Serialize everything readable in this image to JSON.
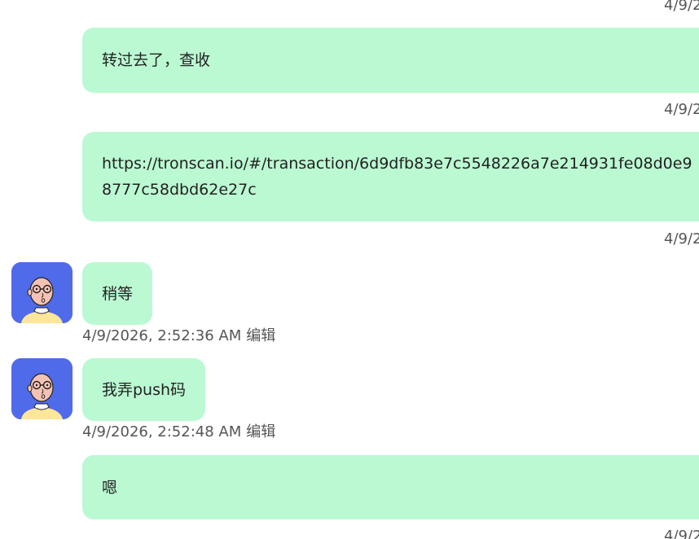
{
  "messages": [
    {
      "text": "转过去了，查收",
      "side": "right"
    },
    {
      "text": "https://tronscan.io/#/transaction/6d9dfb83e7c5548226a7e214931fe08d0e98777c58dbd62e27c",
      "side": "right"
    },
    {
      "text": "稍等",
      "side": "left",
      "timestamp": "4/9/2026, 2:52:36 AM",
      "edit_label": "编辑"
    },
    {
      "text": "我弄push码",
      "side": "left",
      "timestamp": "4/9/2026, 2:52:48 AM",
      "edit_label": "编辑"
    },
    {
      "text": "嗯",
      "side": "right"
    }
  ],
  "right_timestamp_visible": "4/9/2",
  "colors": {
    "bubble": "#bbf9d3",
    "avatar_bg": "#4f6bea",
    "timestamp": "#555555"
  }
}
